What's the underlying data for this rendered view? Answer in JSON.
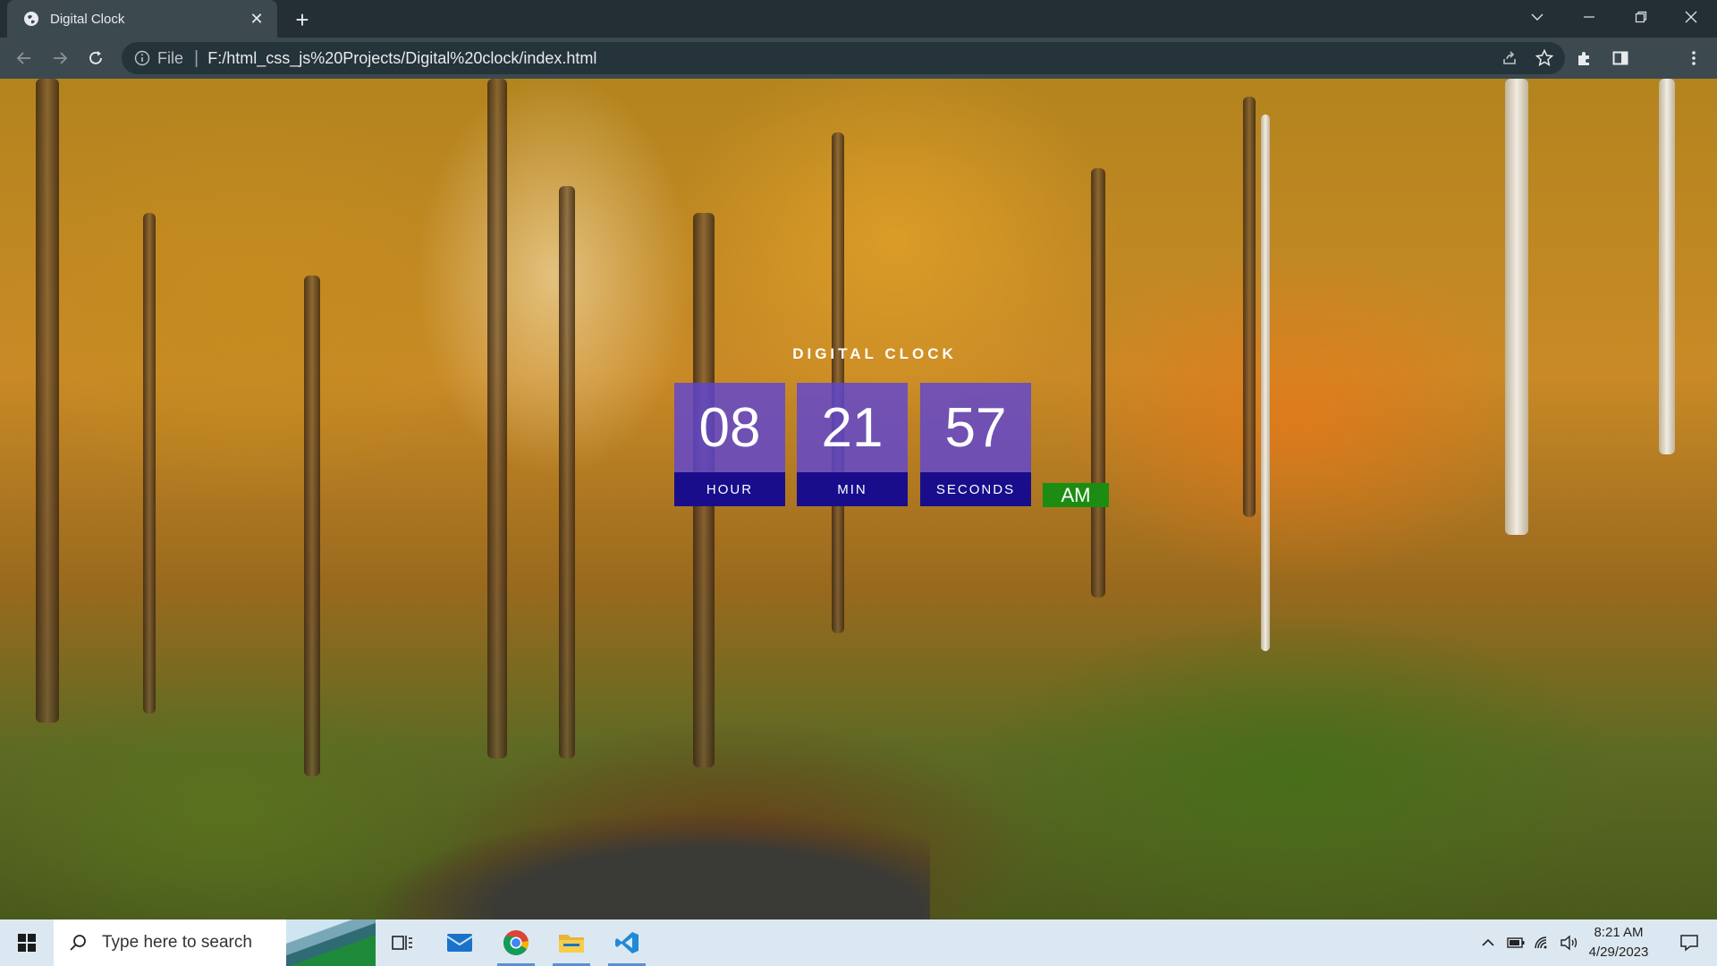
{
  "browser": {
    "tab_title": "Digital Clock",
    "address_scheme": "File",
    "address_url": "F:/html_css_js%20Projects/Digital%20clock/index.html"
  },
  "clock": {
    "title": "DIGITAL CLOCK",
    "hour": "08",
    "hour_label": "HOUR",
    "minute": "21",
    "minute_label": "MIN",
    "second": "57",
    "second_label": "SECONDS",
    "period": "AM"
  },
  "colors": {
    "digit_box": "#5f46d2",
    "label_box": "#1a0d8c",
    "period_box": "#1c8d12"
  },
  "taskbar": {
    "search_placeholder": "Type here to search",
    "time": "8:21 AM",
    "date": "4/29/2023",
    "pinned_icons": [
      "task-view-icon",
      "mail-icon",
      "chrome-icon",
      "file-explorer-icon",
      "vscode-icon"
    ],
    "tray_icons": [
      "chevron-up-icon",
      "battery-icon",
      "wifi-icon",
      "volume-icon",
      "notifications-icon"
    ]
  }
}
